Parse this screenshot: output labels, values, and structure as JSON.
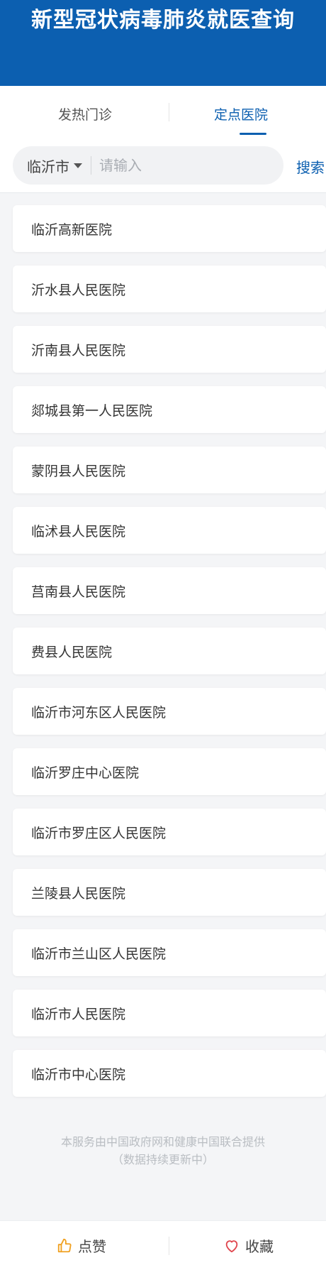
{
  "header": {
    "title": "新型冠状病毒肺炎就医查询"
  },
  "tabs": [
    {
      "label": "发热门诊",
      "active": false
    },
    {
      "label": "定点医院",
      "active": true
    }
  ],
  "search": {
    "city": "临沂市",
    "placeholder": "请输入",
    "value": "",
    "button_label": "搜索"
  },
  "hospitals": [
    "临沂高新医院",
    "沂水县人民医院",
    "沂南县人民医院",
    "郯城县第一人民医院",
    "蒙阴县人民医院",
    "临沭县人民医院",
    "莒南县人民医院",
    "费县人民医院",
    "临沂市河东区人民医院",
    "临沂罗庄中心医院",
    "临沂市罗庄区人民医院",
    "兰陵县人民医院",
    "临沂市兰山区人民医院",
    "临沂市人民医院",
    "临沂市中心医院"
  ],
  "footer": {
    "line1": "本服务由中国政府网和健康中国联合提供",
    "line2": "（数据持续更新中）"
  },
  "bottom_bar": {
    "like_label": "点赞",
    "favorite_label": "收藏"
  },
  "colors": {
    "brand": "#0c5fb0",
    "like_icon": "#f0a020",
    "favorite_icon": "#e0464e"
  },
  "icons": {
    "like": "thumbs-up-icon",
    "favorite": "heart-icon",
    "dropdown": "caret-down-icon"
  }
}
